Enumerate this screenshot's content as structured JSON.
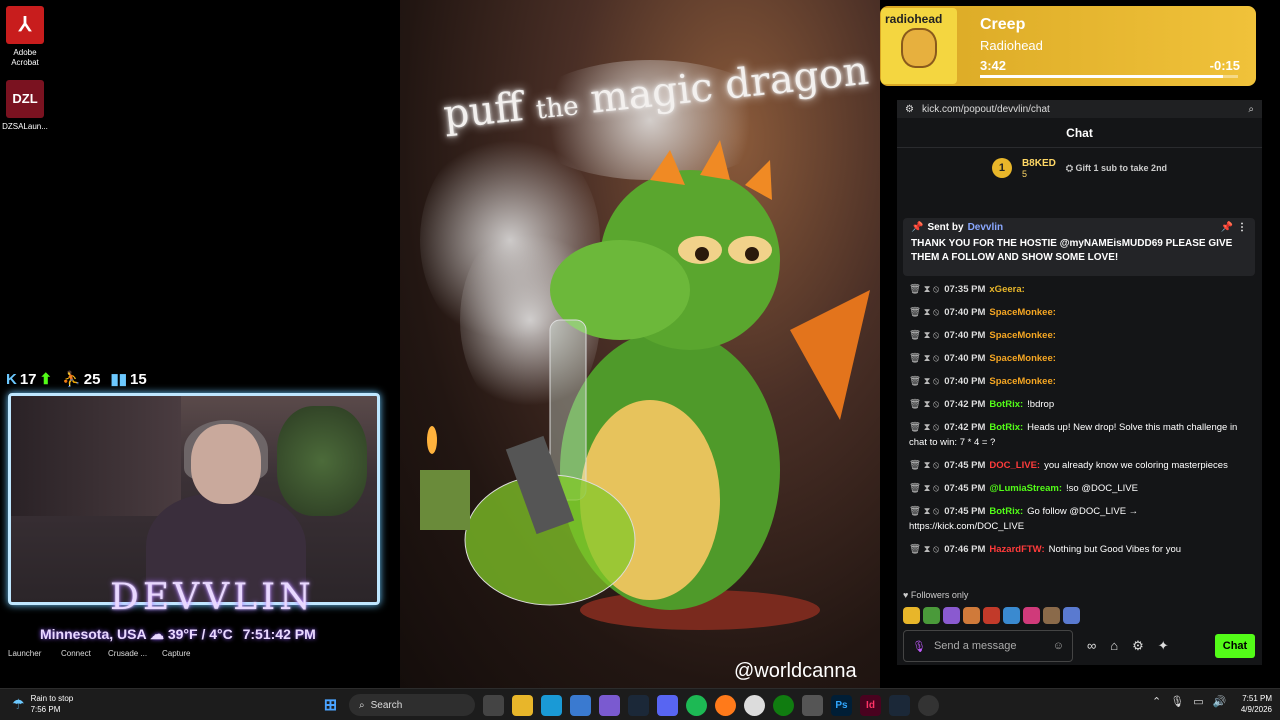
{
  "desktop": {
    "icons": [
      {
        "label": "Adobe\nAcrobat",
        "label_1": "Adobe",
        "label_2": "Acrobat"
      },
      {
        "label": "DZSALaun...",
        "label_1": "DZSALaun..."
      }
    ]
  },
  "stream_stats": {
    "a": "17",
    "b": "25",
    "c": "15"
  },
  "overlay": {
    "streamer_name": "DEVVLIN",
    "location_line": "Minnesota, USA",
    "weather_line": "39°F / 4°C",
    "time_line": "7:51:42 PM",
    "launchers": [
      "Launcher",
      "Connect",
      "Crusade ...",
      "Capture"
    ]
  },
  "art": {
    "title_1": "puff",
    "title_2": "the",
    "title_3": "magic dragon",
    "credit": "@worldcanna"
  },
  "now_playing": {
    "song": "Creep",
    "artist": "Radiohead",
    "album_label": "radiohead",
    "elapsed": "3:42",
    "remaining": "-0:15",
    "progress": 0.94
  },
  "browser": {
    "url": "kick.com/popout/devvlin/chat"
  },
  "chat": {
    "title": "Chat",
    "leaderboard": {
      "rank": "1",
      "user": "B8KED",
      "count": "5",
      "gift_text": "Gift 1 sub to take 2nd"
    },
    "pinned": {
      "sent_by_label": "Sent by",
      "sender": "Devvlin",
      "message": "THANK YOU FOR THE HOSTIE @myNAMEisMUDD69 PLEASE GIVE THEM A FOLLOW AND SHOW SOME LOVE!"
    },
    "messages": [
      {
        "time": "07:35 PM",
        "user": "xGeera:",
        "text": "",
        "color": "#e8b62a"
      },
      {
        "time": "07:40 PM",
        "user": "SpaceMonkee:",
        "text": "",
        "color": "#f5a623"
      },
      {
        "time": "07:40 PM",
        "user": "SpaceMonkee:",
        "text": "",
        "color": "#f5a623"
      },
      {
        "time": "07:40 PM",
        "user": "SpaceMonkee:",
        "text": "",
        "color": "#f5a623"
      },
      {
        "time": "07:40 PM",
        "user": "SpaceMonkee:",
        "text": "",
        "color": "#f5a623"
      },
      {
        "time": "07:42 PM",
        "user": "BotRix:",
        "text": "!bdrop",
        "color": "#53fc18"
      },
      {
        "time": "07:42 PM",
        "user": "BotRix:",
        "text": "Heads up! New drop! Solve this math challenge in chat to win: 7 * 4 = ?",
        "color": "#53fc18"
      },
      {
        "time": "07:45 PM",
        "user": "DOC_LIVE:",
        "text": "you already know we coloring masterpieces",
        "color": "#ff3b3b"
      },
      {
        "time": "07:45 PM",
        "user": "@LumiaStream:",
        "text": "!so @DOC_LIVE",
        "color": "#53fc18"
      },
      {
        "time": "07:45 PM",
        "user": "BotRix:",
        "text": "Go follow @DOC_LIVE → https://kick.com/DOC_LIVE",
        "color": "#53fc18"
      },
      {
        "time": "07:46 PM",
        "user": "HazardFTW:",
        "text": "Nothing but Good Vibes for you",
        "color": "#ff3b3b"
      }
    ],
    "followers_only": "Followers only",
    "input_placeholder": "Send a message",
    "send_label": "Chat"
  },
  "taskbar": {
    "weather_title": "Rain to stop",
    "weather_time": "7:56 PM",
    "search_placeholder": "Search",
    "clock_time": "7:51 PM",
    "clock_date": "4/9/2026"
  }
}
